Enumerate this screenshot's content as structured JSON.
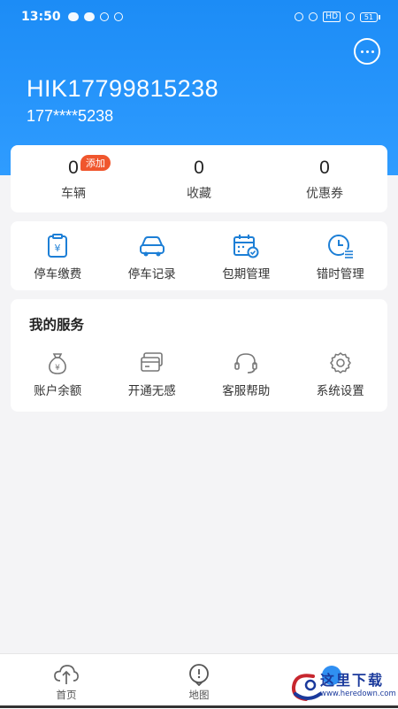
{
  "status_bar": {
    "time": "13:50",
    "battery": "51",
    "network": "HD"
  },
  "header": {
    "username": "HIK17799815238",
    "phone": "177****5238",
    "chat_icon": "more-chat-icon"
  },
  "stats": [
    {
      "value": "0",
      "label": "车辆",
      "badge": "添加"
    },
    {
      "value": "0",
      "label": "收藏"
    },
    {
      "value": "0",
      "label": "优惠券"
    }
  ],
  "quick_actions": [
    {
      "label": "停车缴费",
      "icon": "parking-payment-icon"
    },
    {
      "label": "停车记录",
      "icon": "car-record-icon"
    },
    {
      "label": "包期管理",
      "icon": "calendar-check-icon"
    },
    {
      "label": "错时管理",
      "icon": "clock-list-icon"
    }
  ],
  "services": {
    "title": "我的服务",
    "items": [
      {
        "label": "账户余额",
        "icon": "money-bag-icon"
      },
      {
        "label": "开通无感",
        "icon": "card-icon"
      },
      {
        "label": "客服帮助",
        "icon": "headset-icon"
      },
      {
        "label": "系统设置",
        "icon": "gear-icon"
      }
    ]
  },
  "bottom_nav": [
    {
      "label": "首页",
      "icon": "home-cloud-icon"
    },
    {
      "label": "地图",
      "icon": "map-pin-icon"
    },
    {
      "label": "",
      "icon": "profile-icon"
    }
  ],
  "watermark": {
    "title": "这里下载",
    "url": "www.heredown.com"
  },
  "colors": {
    "header_blue": "#1c8cf6",
    "icon_blue": "#1d7fd6",
    "badge_red": "#f0562d",
    "background": "#f4f4f6"
  }
}
